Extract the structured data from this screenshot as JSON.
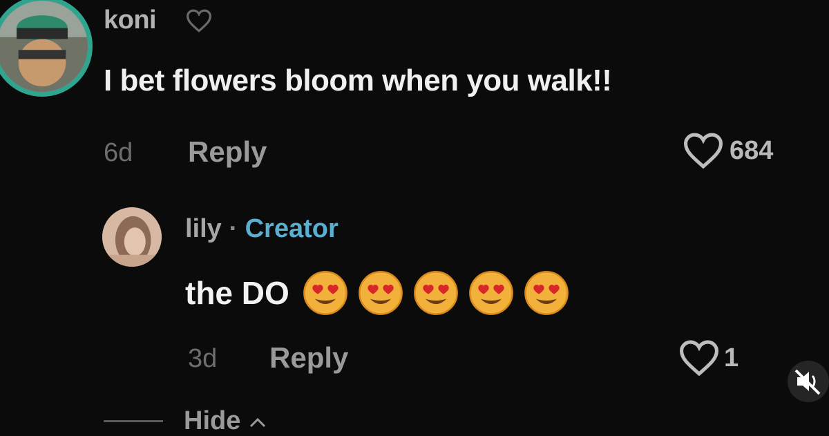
{
  "comments": [
    {
      "username": "koni",
      "text": "I bet flowers bloom when you walk!!",
      "time": "6d",
      "reply_label": "Reply",
      "likes": "684"
    },
    {
      "username": "lily",
      "separator": " · ",
      "badge": "Creator",
      "text": "the DO",
      "emoji_name": "smiling-face-with-heart-eyes",
      "emoji_count": 5,
      "time": "3d",
      "reply_label": "Reply",
      "likes": "1"
    }
  ],
  "hide_label": "Hide",
  "colors": {
    "background": "#0b0b0c",
    "avatar_ring": "#2fa58f",
    "creator_badge": "#5aaed0"
  },
  "icons": {
    "like": "heart-outline-icon",
    "mute": "speaker-muted-icon",
    "hide": "chevron-up-icon"
  }
}
